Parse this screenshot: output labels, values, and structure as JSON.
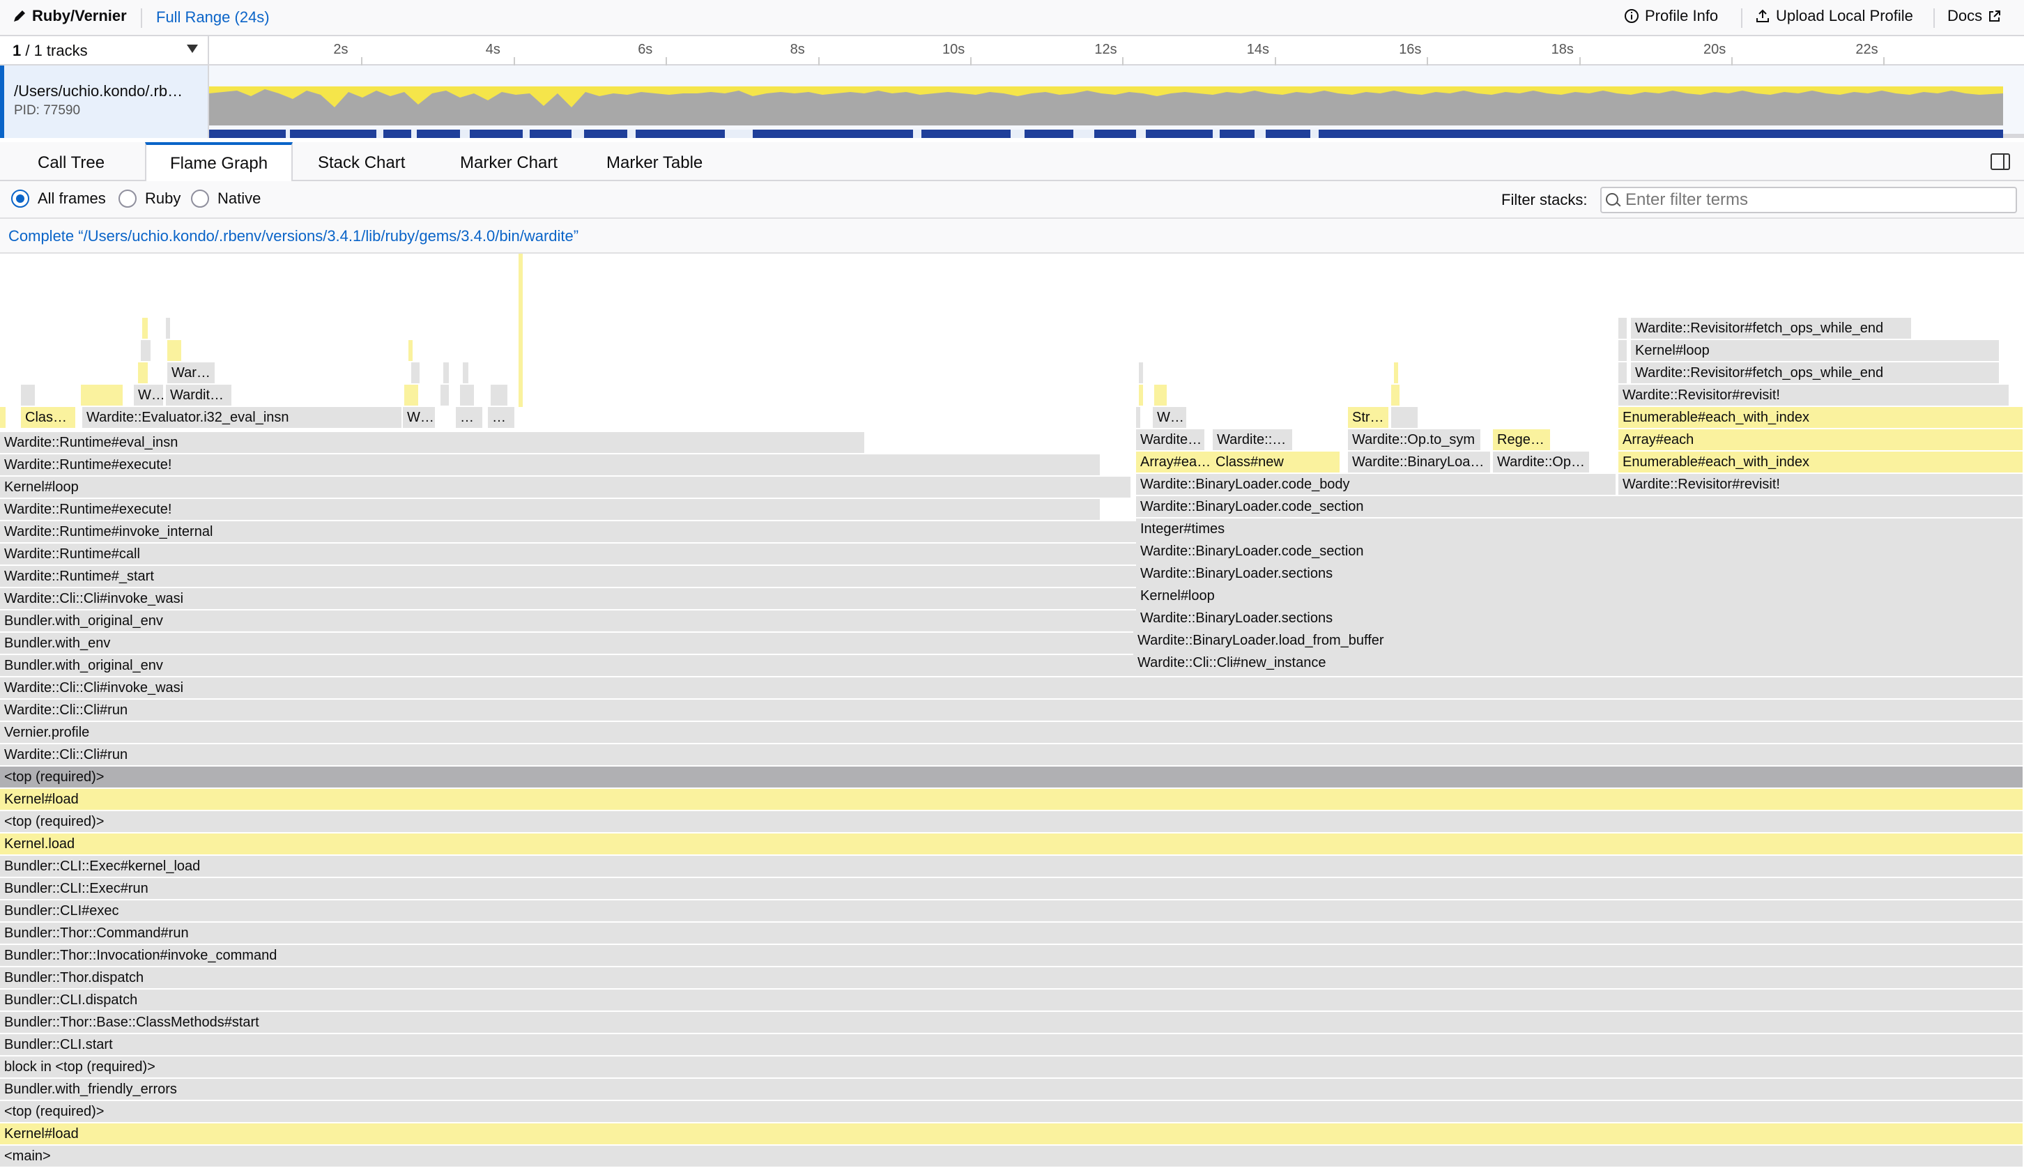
{
  "topbar": {
    "app_title": "Ruby/Vernier",
    "range": "Full Range (24s)",
    "profile_info": "Profile Info",
    "upload": "Upload Local Profile",
    "docs": "Docs"
  },
  "timeline": {
    "track_count_bold": "1",
    "track_count_rest": " / 1 tracks",
    "ticks": [
      "2s",
      "4s",
      "6s",
      "8s",
      "10s",
      "12s",
      "14s",
      "16s",
      "18s",
      "20s",
      "22s"
    ],
    "track_name": "/Users/uchio.kondo/.rb…",
    "track_pid": "PID: 77590"
  },
  "colors": {
    "accent": "#0a64c8",
    "ruby_frame": "#faf29e",
    "native_frame": "#e2e2e2",
    "graph_yellow": "#f5e54a",
    "graph_gray": "#a8a8a8",
    "graph_blue": "#1f3f9a"
  },
  "tabs": [
    "Call Tree",
    "Flame Graph",
    "Stack Chart",
    "Marker Chart",
    "Marker Table"
  ],
  "selected_tab": "Flame Graph",
  "settings": {
    "all_frames": "All frames",
    "ruby": "Ruby",
    "native": "Native",
    "filter_label": "Filter stacks:",
    "filter_placeholder": "Enter filter terms"
  },
  "breadcrumb": "Complete “/Users/uchio.kondo/.rbenv/versions/3.4.1/lib/ruby/gems/3.4.0/bin/wardite”",
  "flame": {
    "base_labels": [
      "<main>",
      "Kernel#load",
      "<top (required)>",
      "Bundler.with_friendly_errors",
      "block in <top (required)>",
      "Bundler::CLI.start",
      "Bundler::Thor::Base::ClassMethods#start",
      "Bundler::CLI.dispatch",
      "Bundler::Thor.dispatch",
      "Bundler::Thor::Invocation#invoke_command",
      "Bundler::Thor::Command#run",
      "Bundler::CLI#exec",
      "Bundler::CLI::Exec#run",
      "Bundler::CLI::Exec#kernel_load",
      "Kernel.load",
      "<top (required)>",
      "Kernel#load",
      "<top (required)>",
      "Wardite::Cli::Cli#run",
      "Vernier.profile",
      "Wardite::Cli::Cli#run",
      "Wardite::Cli::Cli#invoke_wasi",
      "Bundler.with_original_env",
      "Bundler.with_env",
      "Bundler.with_original_env",
      "Wardite::Cli::Cli#invoke_wasi",
      "Wardite::Runtime#_start",
      "Wardite::Runtime#call",
      "Wardite::Runtime#invoke_internal",
      "Wardite::Runtime#execute!",
      "Kernel#loop",
      "Wardite::Runtime#execute!",
      "Wardite::Runtime#eval_insn"
    ],
    "left_labels": {
      "clas": "Clas…",
      "eval_i32": "Wardite::Evaluator.i32_eval_insn",
      "w1": "W…",
      "dots1": "…",
      "dots2": "…",
      "w2": "W…",
      "wardit": "Wardit…",
      "war": "War…"
    },
    "middle_labels": {
      "new_instance": "Wardite::Cli::Cli#new_instance",
      "load_from_buffer": "Wardite::BinaryLoader.load_from_buffer",
      "sections1": "Wardite::BinaryLoader.sections",
      "kernel_loop": "Kernel#loop",
      "sections2": "Wardite::BinaryLoader.sections",
      "code_section1": "Wardite::BinaryLoader.code_section",
      "integer_times": "Integer#times",
      "code_section2": "Wardite::BinaryLoader.code_section",
      "code_body": "Wardite::BinaryLoader.code_body",
      "array_each_short": "Array#ea…",
      "class_new": "Class#new",
      "binaryloa": "Wardite::BinaryLoa…",
      "op": "Wardite::Op…",
      "wardite_short1": "Wardite…",
      "wardite_colon": "Wardite::…",
      "op_to_sym": "Wardite::Op.to_sym",
      "rege": "Rege…",
      "w3": "W…",
      "str": "Str…"
    },
    "right_labels": {
      "revisit1": "Wardite::Revisitor#revisit!",
      "each_with_index1": "Enumerable#each_with_index",
      "array_each": "Array#each",
      "each_with_index2": "Enumerable#each_with_index",
      "revisit2": "Wardite::Revisitor#revisit!",
      "fetch_ops1": "Wardite::Revisitor#fetch_ops_while_end",
      "kernel_loop": "Kernel#loop",
      "fetch_ops2": "Wardite::Revisitor#fetch_ops_while_end"
    }
  }
}
